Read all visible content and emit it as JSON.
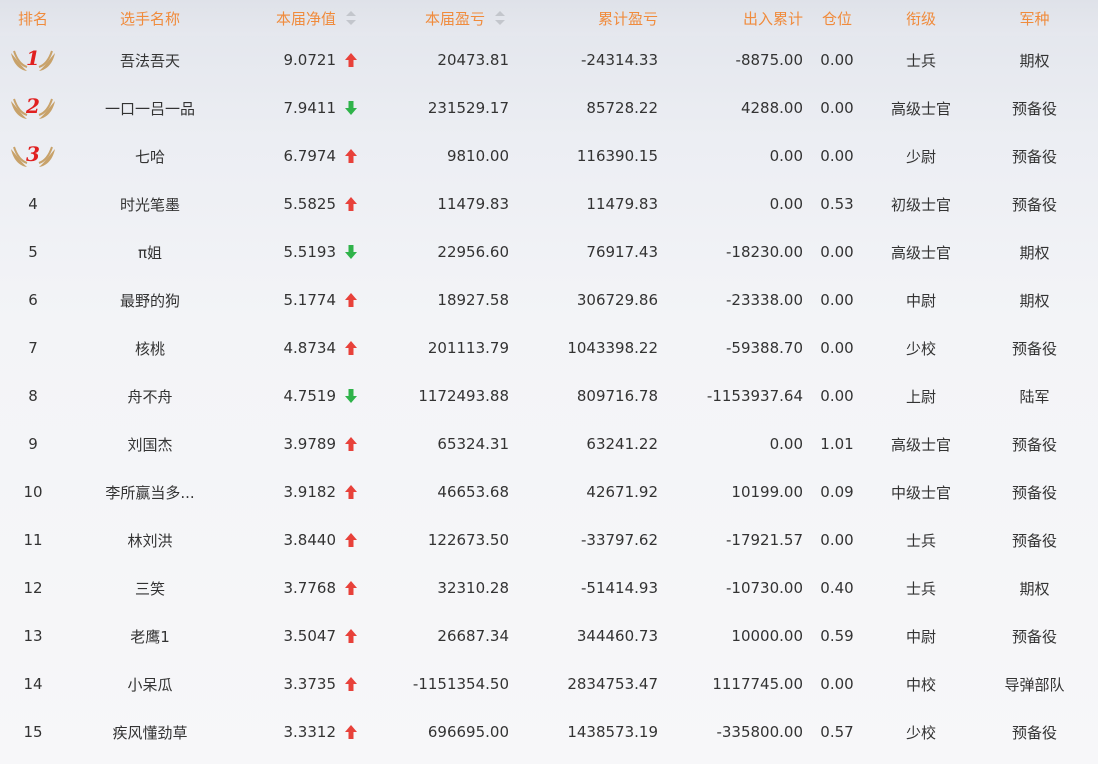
{
  "headers": {
    "rank": "排名",
    "name": "选手名称",
    "nav": "本届净值",
    "pl": "本届盈亏",
    "cum": "累计盈亏",
    "flow": "出入累计",
    "pos": "仓位",
    "title": "衔级",
    "arm": "军种"
  },
  "colors": {
    "header_text": "#f08b3c",
    "up": "#e8413a",
    "down": "#2fb34a",
    "medal": "#c8a26a",
    "medal_number": "#e02020"
  },
  "rows": [
    {
      "rank": "1",
      "name": "吾法吾天",
      "nav": "9.0721",
      "trend": "up",
      "pl": "20473.81",
      "cum": "-24314.33",
      "flow": "-8875.00",
      "pos": "0.00",
      "title": "士兵",
      "arm": "期权"
    },
    {
      "rank": "2",
      "name": "一口一吕一品",
      "nav": "7.9411",
      "trend": "down",
      "pl": "231529.17",
      "cum": "85728.22",
      "flow": "4288.00",
      "pos": "0.00",
      "title": "高级士官",
      "arm": "预备役"
    },
    {
      "rank": "3",
      "name": "七哈",
      "nav": "6.7974",
      "trend": "up",
      "pl": "9810.00",
      "cum": "116390.15",
      "flow": "0.00",
      "pos": "0.00",
      "title": "少尉",
      "arm": "预备役"
    },
    {
      "rank": "4",
      "name": "时光笔墨",
      "nav": "5.5825",
      "trend": "up",
      "pl": "11479.83",
      "cum": "11479.83",
      "flow": "0.00",
      "pos": "0.53",
      "title": "初级士官",
      "arm": "预备役"
    },
    {
      "rank": "5",
      "name": "π姐",
      "nav": "5.5193",
      "trend": "down",
      "pl": "22956.60",
      "cum": "76917.43",
      "flow": "-18230.00",
      "pos": "0.00",
      "title": "高级士官",
      "arm": "期权"
    },
    {
      "rank": "6",
      "name": "最野的狗",
      "nav": "5.1774",
      "trend": "up",
      "pl": "18927.58",
      "cum": "306729.86",
      "flow": "-23338.00",
      "pos": "0.00",
      "title": "中尉",
      "arm": "期权"
    },
    {
      "rank": "7",
      "name": "核桃",
      "nav": "4.8734",
      "trend": "up",
      "pl": "201113.79",
      "cum": "1043398.22",
      "flow": "-59388.70",
      "pos": "0.00",
      "title": "少校",
      "arm": "预备役"
    },
    {
      "rank": "8",
      "name": "舟不舟",
      "nav": "4.7519",
      "trend": "down",
      "pl": "1172493.88",
      "cum": "809716.78",
      "flow": "-1153937.64",
      "pos": "0.00",
      "title": "上尉",
      "arm": "陆军"
    },
    {
      "rank": "9",
      "name": "刘国杰",
      "nav": "3.9789",
      "trend": "up",
      "pl": "65324.31",
      "cum": "63241.22",
      "flow": "0.00",
      "pos": "1.01",
      "title": "高级士官",
      "arm": "预备役"
    },
    {
      "rank": "10",
      "name": "李所赢当多...",
      "nav": "3.9182",
      "trend": "up",
      "pl": "46653.68",
      "cum": "42671.92",
      "flow": "10199.00",
      "pos": "0.09",
      "title": "中级士官",
      "arm": "预备役"
    },
    {
      "rank": "11",
      "name": "林刘洪",
      "nav": "3.8440",
      "trend": "up",
      "pl": "122673.50",
      "cum": "-33797.62",
      "flow": "-17921.57",
      "pos": "0.00",
      "title": "士兵",
      "arm": "预备役"
    },
    {
      "rank": "12",
      "name": "三笑",
      "nav": "3.7768",
      "trend": "up",
      "pl": "32310.28",
      "cum": "-51414.93",
      "flow": "-10730.00",
      "pos": "0.40",
      "title": "士兵",
      "arm": "期权"
    },
    {
      "rank": "13",
      "name": "老鹰1",
      "nav": "3.5047",
      "trend": "up",
      "pl": "26687.34",
      "cum": "344460.73",
      "flow": "10000.00",
      "pos": "0.59",
      "title": "中尉",
      "arm": "预备役"
    },
    {
      "rank": "14",
      "name": "小呆瓜",
      "nav": "3.3735",
      "trend": "up",
      "pl": "-1151354.50",
      "cum": "2834753.47",
      "flow": "1117745.00",
      "pos": "0.00",
      "title": "中校",
      "arm": "导弹部队"
    },
    {
      "rank": "15",
      "name": "疾风懂劲草",
      "nav": "3.3312",
      "trend": "up",
      "pl": "696695.00",
      "cum": "1438573.19",
      "flow": "-335800.00",
      "pos": "0.57",
      "title": "少校",
      "arm": "预备役"
    }
  ]
}
